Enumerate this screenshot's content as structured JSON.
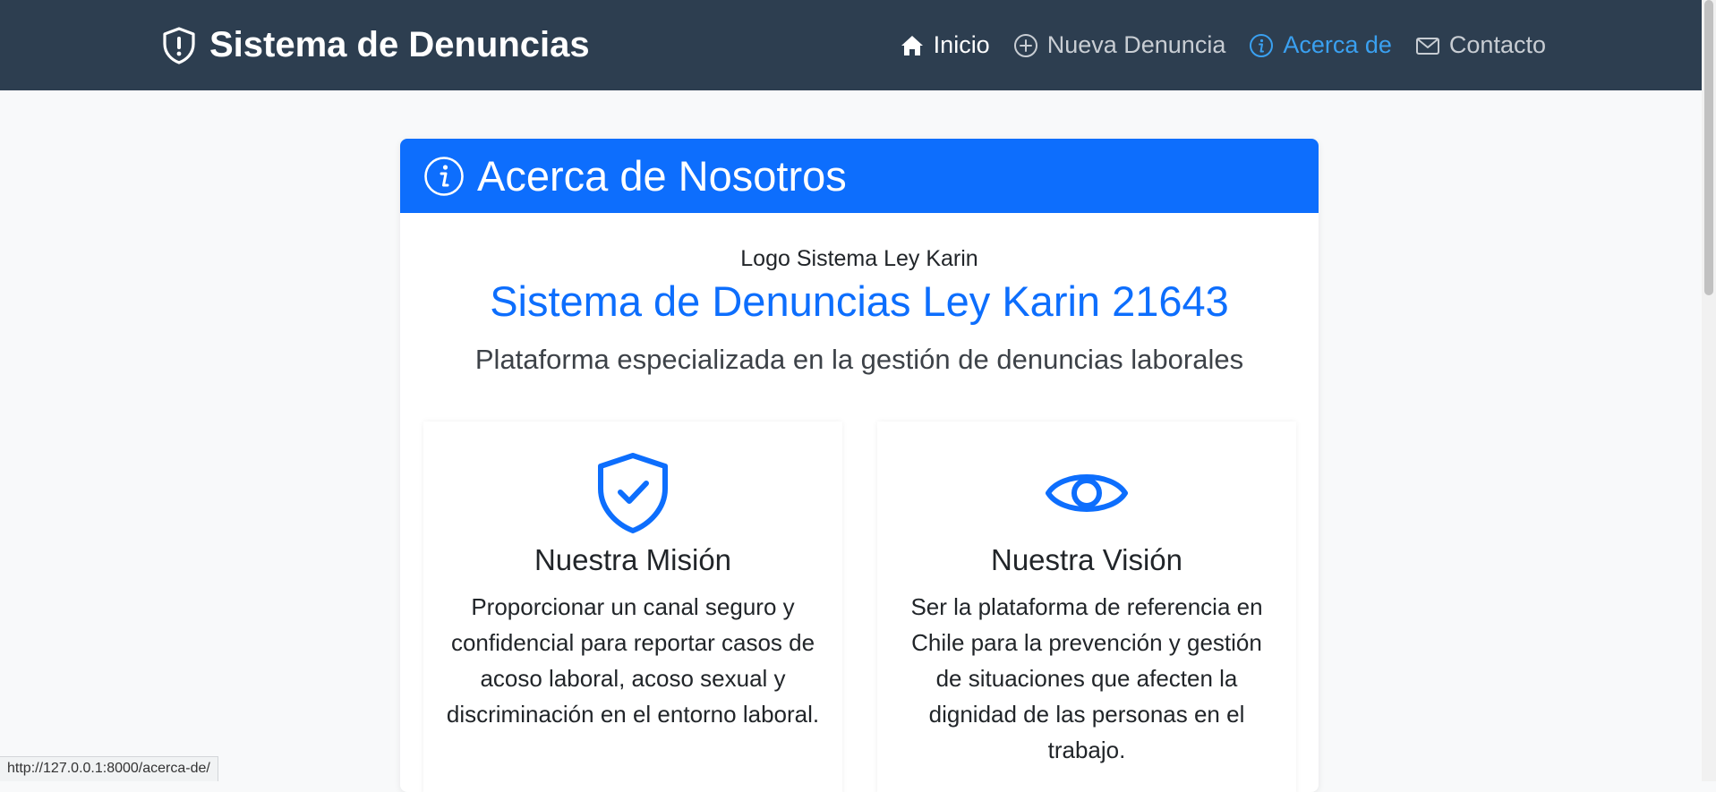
{
  "navbar": {
    "brand": "Sistema de Denuncias",
    "links": [
      {
        "label": "Inicio",
        "icon": "house-icon"
      },
      {
        "label": "Nueva Denuncia",
        "icon": "plus-circle-icon"
      },
      {
        "label": "Acerca de",
        "icon": "info-circle-icon",
        "active": true
      },
      {
        "label": "Contacto",
        "icon": "envelope-icon"
      }
    ]
  },
  "card": {
    "header_title": "Acerca de Nosotros",
    "logo_alt": "Logo Sistema Ley Karin",
    "title": "Sistema de Denuncias Ley Karin 21643",
    "subtitle": "Plataforma especializada en la gestión de denuncias laborales",
    "features": [
      {
        "icon": "shield-check-icon",
        "title": "Nuestra Misión",
        "text": "Proporcionar un canal seguro y confidencial para reportar casos de acoso laboral, acoso sexual y discriminación en el entorno laboral."
      },
      {
        "icon": "eye-icon",
        "title": "Nuestra Visión",
        "text": "Ser la plataforma de referencia en Chile para la prevención y gestión de situaciones que afecten la dignidad de las personas en el trabajo."
      }
    ]
  },
  "status_bar": {
    "url": "http://127.0.0.1:8000/acerca-de/"
  },
  "colors": {
    "navbar": "#2d3e50",
    "primary": "#0d6efd",
    "active_link": "#3aa0f0"
  }
}
